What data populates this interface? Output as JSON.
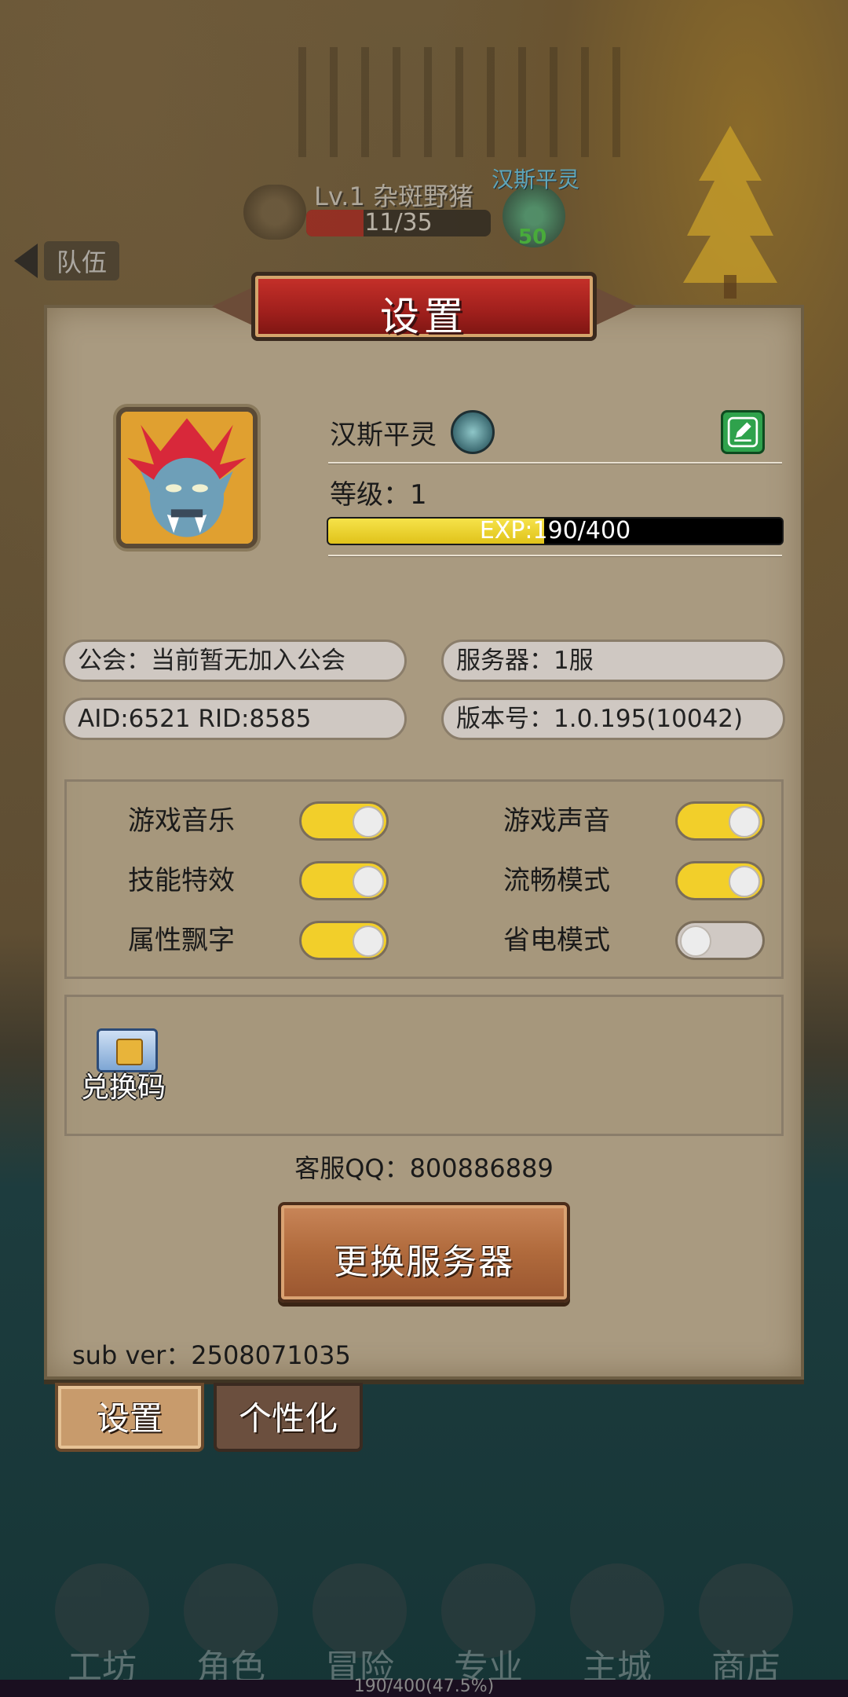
{
  "scene": {
    "enemy_name": "Lv.1 杂斑野猪",
    "enemy_hp": "11/35",
    "enemy_hp_fraction": 0.31,
    "hero_mini_name": "汉斯平灵",
    "hero_mini_level": "50",
    "team_label": "队伍"
  },
  "panel": {
    "title": "设置",
    "player": {
      "name": "汉斯平灵",
      "level_text": "等级：1",
      "exp_text": "EXP:190/400",
      "exp_fraction": 0.475
    },
    "info": {
      "guild": "公会：当前暂无加入公会",
      "server": "服务器：1服",
      "ids": "AID:6521   RID:8585",
      "version": "版本号：1.0.195(10042)"
    },
    "toggles": [
      {
        "label": "游戏音乐",
        "on": true
      },
      {
        "label": "游戏声音",
        "on": true
      },
      {
        "label": "技能特效",
        "on": true
      },
      {
        "label": "流畅模式",
        "on": true
      },
      {
        "label": "属性飘字",
        "on": true
      },
      {
        "label": "省电模式",
        "on": false
      }
    ],
    "redeem_label": "兑换码",
    "customer_service": "客服QQ：800886889",
    "change_server_label": "更换服务器",
    "sub_version": "sub ver：2508071035"
  },
  "tabs": [
    {
      "label": "设置",
      "active": true
    },
    {
      "label": "个性化",
      "active": false
    }
  ],
  "bottom_nav": {
    "items": [
      "工坊",
      "角色",
      "冒险",
      "专业",
      "主城",
      "商店"
    ],
    "exp_text": "190/400(47.5%)"
  },
  "icons": {
    "avatar": "troll-portrait-icon",
    "badge": "weapon-badge-icon",
    "edit": "pencil-edit-icon",
    "redeem": "gift-card-icon"
  },
  "colors": {
    "panel_bg": "#a99a80",
    "banner_red": "#c7312a",
    "toggle_on": "#f2cf2a",
    "toggle_off": "#d0c9c4",
    "edit_green": "#2fa24c",
    "exp_yellow": "#f6e34a"
  }
}
